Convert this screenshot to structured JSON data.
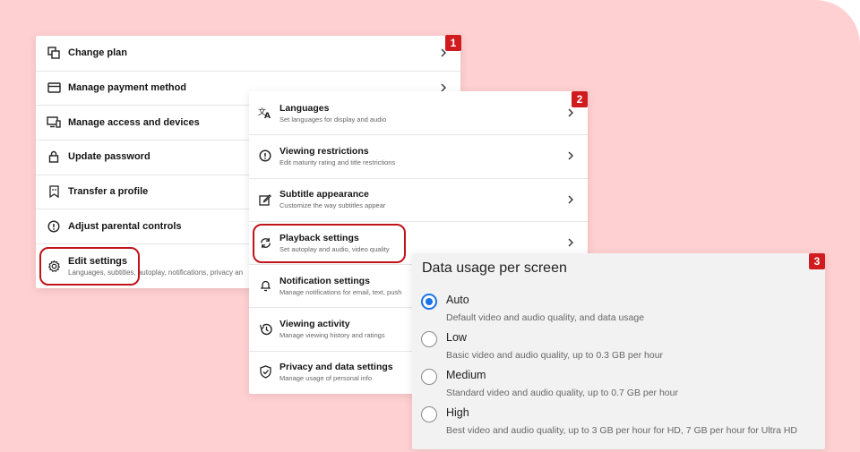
{
  "colors": {
    "background": "#ffd0d1",
    "accent": "#d01c1f",
    "radio_selected": "#1a73e8"
  },
  "account_menu": {
    "badge": "1",
    "items": [
      {
        "label": "Change plan",
        "icon": "change-plan-icon"
      },
      {
        "label": "Manage payment method",
        "icon": "credit-card-icon"
      },
      {
        "label": "Manage access and devices",
        "icon": "devices-icon"
      },
      {
        "label": "Update password",
        "icon": "lock-icon"
      },
      {
        "label": "Transfer a profile",
        "icon": "transfer-profile-icon"
      },
      {
        "label": "Adjust parental controls",
        "icon": "parental-controls-icon"
      },
      {
        "label": "Edit settings",
        "sub": "Languages, subtitles, autoplay, notifications, privacy an",
        "icon": "gear-icon"
      }
    ]
  },
  "settings_menu": {
    "badge": "2",
    "items": [
      {
        "label": "Languages",
        "sub": "Set languages for display and audio",
        "icon": "translate-icon"
      },
      {
        "label": "Viewing restrictions",
        "sub": "Edit maturity rating and title restrictions",
        "icon": "alert-circle-icon"
      },
      {
        "label": "Subtitle appearance",
        "sub": "Customize the way subtitles appear",
        "icon": "edit-box-icon"
      },
      {
        "label": "Playback settings",
        "sub": "Set autoplay and audio, video quality",
        "icon": "refresh-icon"
      },
      {
        "label": "Notification settings",
        "sub": "Manage notifications for email, text, push",
        "icon": "bell-icon"
      },
      {
        "label": "Viewing activity",
        "sub": "Manage viewing history and ratings",
        "icon": "history-icon"
      },
      {
        "label": "Privacy and data settings",
        "sub": "Manage usage of personal info",
        "icon": "shield-icon"
      }
    ]
  },
  "data_usage": {
    "badge": "3",
    "title": "Data usage per screen",
    "selected": "Auto",
    "options": [
      {
        "label": "Auto",
        "sub": "Default video and audio quality, and data usage"
      },
      {
        "label": "Low",
        "sub": "Basic video and audio quality, up to 0.3 GB per hour"
      },
      {
        "label": "Medium",
        "sub": "Standard video and audio quality, up to 0.7 GB per hour"
      },
      {
        "label": "High",
        "sub": "Best video and audio quality, up to 3 GB per hour for HD, 7 GB per hour for Ultra HD"
      }
    ]
  }
}
